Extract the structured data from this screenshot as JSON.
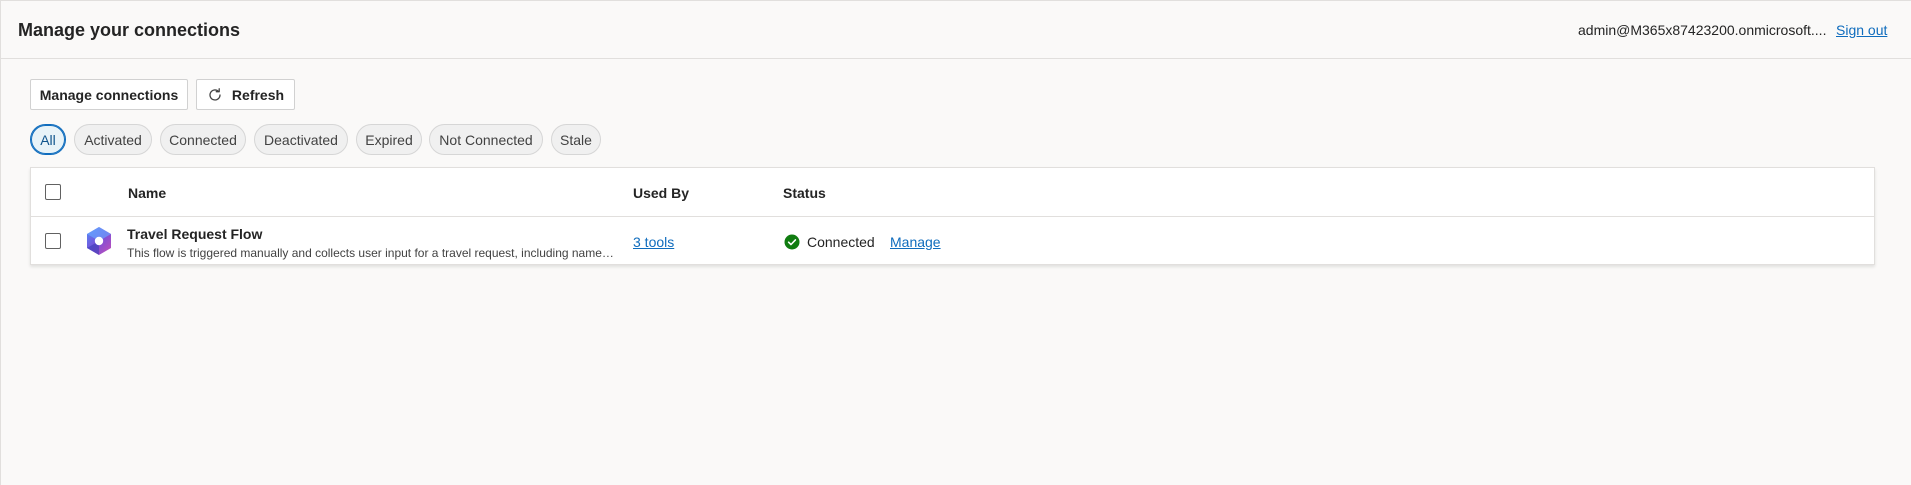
{
  "header": {
    "title": "Manage your connections",
    "user_email": "admin@M365x87423200.onmicrosoft....",
    "sign_out": "Sign out"
  },
  "toolbar": {
    "manage_connections": "Manage connections",
    "refresh": "Refresh"
  },
  "filters": {
    "items": [
      {
        "label": "All",
        "active": true
      },
      {
        "label": "Activated"
      },
      {
        "label": "Connected"
      },
      {
        "label": "Deactivated"
      },
      {
        "label": "Expired"
      },
      {
        "label": "Not Connected"
      },
      {
        "label": "Stale"
      }
    ]
  },
  "table": {
    "columns": {
      "name": "Name",
      "used_by": "Used By",
      "status": "Status"
    },
    "rows": [
      {
        "name": "Travel Request Flow",
        "description": "This flow is triggered manually and collects user input for a travel request, including name, ...",
        "used_by": "3 tools",
        "status": "Connected",
        "action": "Manage"
      }
    ]
  },
  "colors": {
    "accent": "#0f6cbd",
    "status_connected": "#107c10",
    "background": "#faf9f8"
  },
  "icons": {
    "refresh": "refresh-icon",
    "flow": "power-automate-flow-icon",
    "status": "check-circle-icon"
  }
}
